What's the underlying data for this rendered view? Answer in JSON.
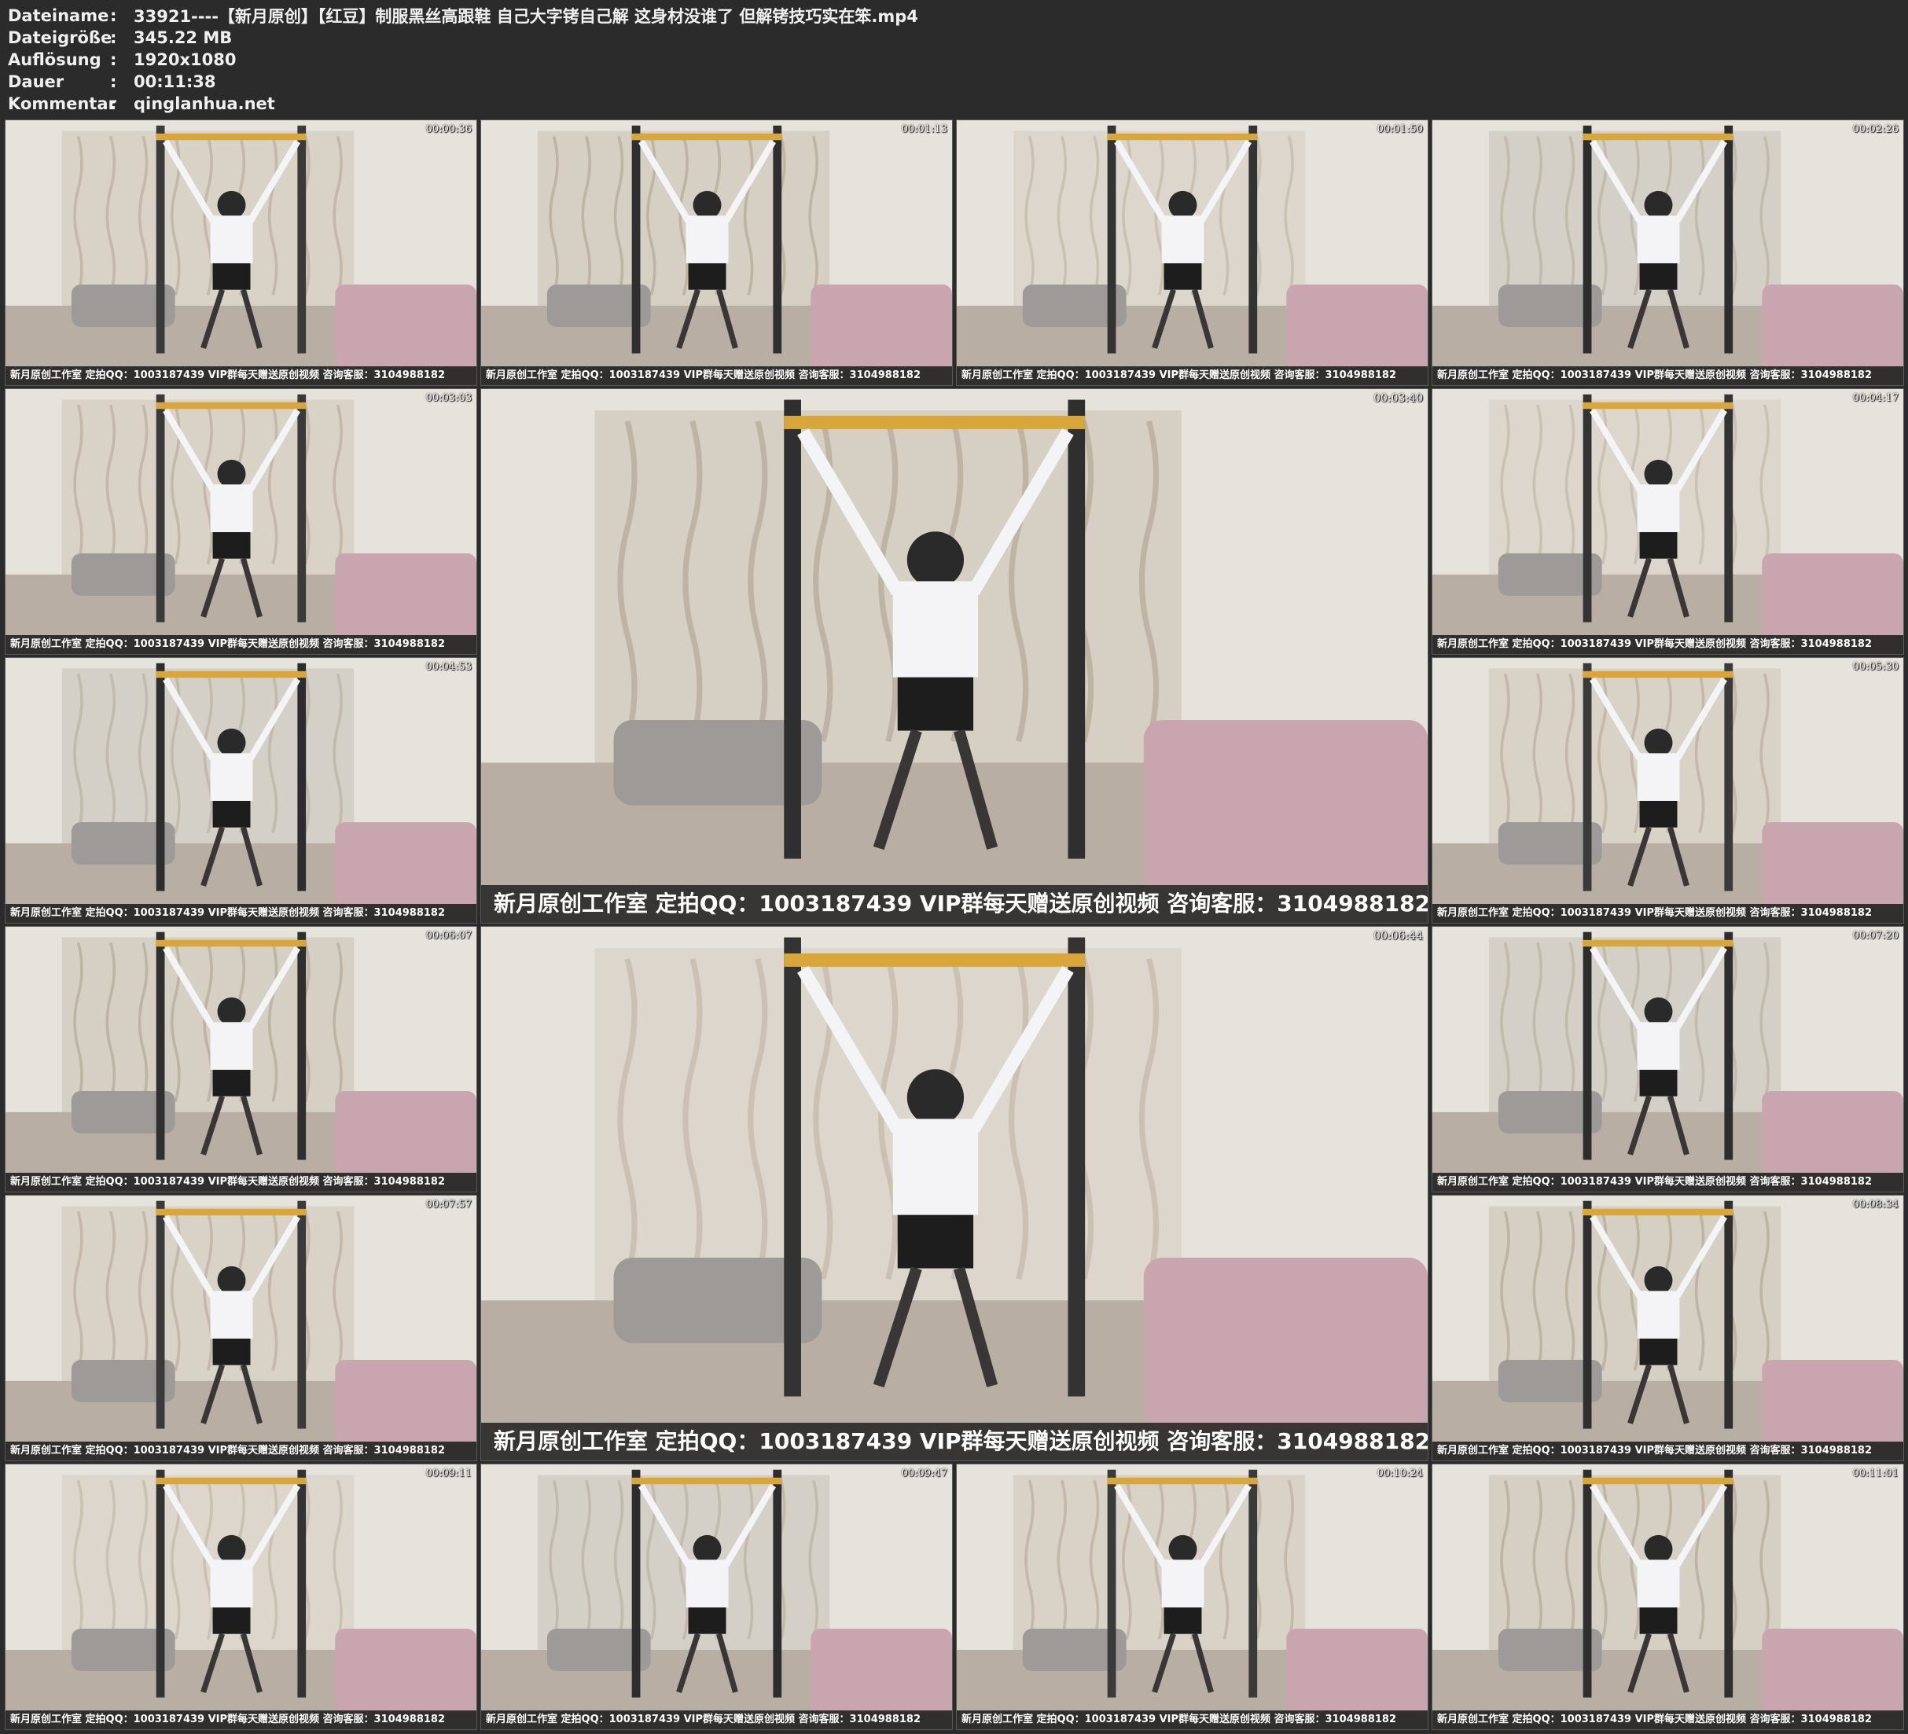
{
  "meta": [
    {
      "label": "Dateiname",
      "sep": ":",
      "value": "33921----【新月原创】【红豆】制服黑丝高跟鞋 自己大字铐自己解 这身材没谁了 但解铐技巧实在笨.mp4"
    },
    {
      "label": "Dateigröße",
      "sep": ":",
      "value": "345.22 MB"
    },
    {
      "label": "Auflösung",
      "sep": ":",
      "value": "1920x1080"
    },
    {
      "label": "Dauer",
      "sep": ":",
      "value": "00:11:38"
    },
    {
      "label": "Kommentar",
      "sep": ":",
      "value": "qinglanhua.net"
    }
  ],
  "watermark_small": "新月原创工作室  定拍QQ：1003187439 VIP群每天赠送原创视频 咨询客服：3104988182",
  "watermark_big": "新月原创工作室  定拍QQ：1003187439 VIP群每天赠送原创视频 咨询客服：3104988182",
  "thumbnails": [
    {
      "time": "00:00:36"
    },
    {
      "time": "00:01:13"
    },
    {
      "time": "00:01:50"
    },
    {
      "time": "00:02:26"
    },
    {
      "time": "00:03:03"
    },
    {
      "time": "00:03:40"
    },
    {
      "time": "00:04:17"
    },
    {
      "time": "00:04:53"
    },
    {
      "time": "00:05:30"
    },
    {
      "time": "00:06:07"
    },
    {
      "time": "00:06:44"
    },
    {
      "time": "00:07:20"
    },
    {
      "time": "00:07:57"
    },
    {
      "time": "00:08:34"
    },
    {
      "time": "00:09:11"
    },
    {
      "time": "00:09:47"
    },
    {
      "time": "00:10:24"
    },
    {
      "time": "00:11:01"
    }
  ]
}
